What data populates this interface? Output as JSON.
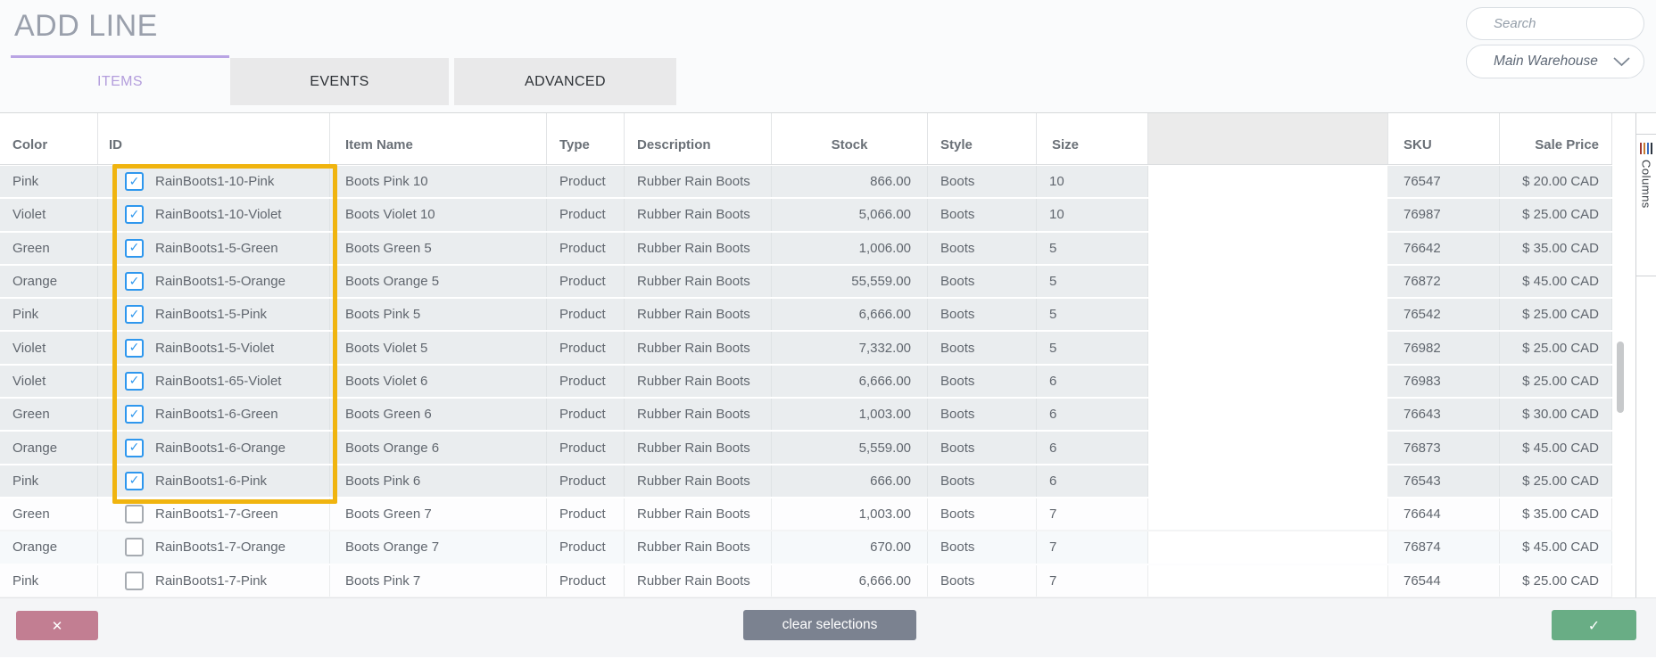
{
  "window": {
    "title": "ADD LINE"
  },
  "tabs": [
    {
      "label": "ITEMS",
      "active": true
    },
    {
      "label": "EVENTS",
      "active": false
    },
    {
      "label": "ADVANCED",
      "active": false
    }
  ],
  "search": {
    "placeholder": "Search"
  },
  "warehouse_dropdown": {
    "value": "Main Warehouse"
  },
  "columns_panel": {
    "label": "Columns"
  },
  "icons": {
    "check": "✓",
    "close": "✕",
    "search": "magnifier-icon",
    "chevron": "chevron-down-icon",
    "columns": "columns-bars-icon"
  },
  "colors": {
    "accent_purple": "#b39ddc",
    "tab_underline": "#b9a4e4",
    "highlight_yellow": "#f0b40f",
    "checkbox_blue": "#2e97ee",
    "selected_row_bg": "#eaedef",
    "cancel_button": "#c27e92",
    "clear_button": "#7b8290",
    "confirm_button": "#69ad85"
  },
  "table": {
    "columns": [
      "Color",
      "ID",
      "Item Name",
      "Type",
      "Description",
      "Stock",
      "Style",
      "Size",
      "",
      "SKU",
      "Sale Price"
    ],
    "rows": [
      {
        "color": "Pink",
        "id": "RainBoots1-10-Pink",
        "item_name": "Boots Pink 10",
        "type": "Product",
        "description": "Rubber Rain Boots",
        "stock": "866.00",
        "style": "Boots",
        "size": "10",
        "sku": "76547",
        "sale_price": "$ 20.00 CAD",
        "checked": true
      },
      {
        "color": "Violet",
        "id": "RainBoots1-10-Violet",
        "item_name": "Boots Violet 10",
        "type": "Product",
        "description": "Rubber Rain Boots",
        "stock": "5,066.00",
        "style": "Boots",
        "size": "10",
        "sku": "76987",
        "sale_price": "$ 25.00 CAD",
        "checked": true
      },
      {
        "color": "Green",
        "id": "RainBoots1-5-Green",
        "item_name": "Boots Green 5",
        "type": "Product",
        "description": "Rubber Rain Boots",
        "stock": "1,006.00",
        "style": "Boots",
        "size": "5",
        "sku": "76642",
        "sale_price": "$ 35.00 CAD",
        "checked": true
      },
      {
        "color": "Orange",
        "id": "RainBoots1-5-Orange",
        "item_name": "Boots Orange 5",
        "type": "Product",
        "description": "Rubber Rain Boots",
        "stock": "55,559.00",
        "style": "Boots",
        "size": "5",
        "sku": "76872",
        "sale_price": "$ 45.00 CAD",
        "checked": true
      },
      {
        "color": "Pink",
        "id": "RainBoots1-5-Pink",
        "item_name": "Boots Pink 5",
        "type": "Product",
        "description": "Rubber Rain Boots",
        "stock": "6,666.00",
        "style": "Boots",
        "size": "5",
        "sku": "76542",
        "sale_price": "$ 25.00 CAD",
        "checked": true
      },
      {
        "color": "Violet",
        "id": "RainBoots1-5-Violet",
        "item_name": "Boots Violet 5",
        "type": "Product",
        "description": "Rubber Rain Boots",
        "stock": "7,332.00",
        "style": "Boots",
        "size": "5",
        "sku": "76982",
        "sale_price": "$ 25.00 CAD",
        "checked": true
      },
      {
        "color": "Violet",
        "id": "RainBoots1-65-Violet",
        "item_name": "Boots Violet 6",
        "type": "Product",
        "description": "Rubber Rain Boots",
        "stock": "6,666.00",
        "style": "Boots",
        "size": "6",
        "sku": "76983",
        "sale_price": "$ 25.00 CAD",
        "checked": true
      },
      {
        "color": "Green",
        "id": "RainBoots1-6-Green",
        "item_name": "Boots Green 6",
        "type": "Product",
        "description": "Rubber Rain Boots",
        "stock": "1,003.00",
        "style": "Boots",
        "size": "6",
        "sku": "76643",
        "sale_price": "$ 30.00 CAD",
        "checked": true
      },
      {
        "color": "Orange",
        "id": "RainBoots1-6-Orange",
        "item_name": "Boots Orange 6",
        "type": "Product",
        "description": "Rubber Rain Boots",
        "stock": "5,559.00",
        "style": "Boots",
        "size": "6",
        "sku": "76873",
        "sale_price": "$ 45.00 CAD",
        "checked": true
      },
      {
        "color": "Pink",
        "id": "RainBoots1-6-Pink",
        "item_name": "Boots Pink 6",
        "type": "Product",
        "description": "Rubber Rain Boots",
        "stock": "666.00",
        "style": "Boots",
        "size": "6",
        "sku": "76543",
        "sale_price": "$ 25.00 CAD",
        "checked": true
      },
      {
        "color": "Green",
        "id": "RainBoots1-7-Green",
        "item_name": "Boots Green 7",
        "type": "Product",
        "description": "Rubber Rain Boots",
        "stock": "1,003.00",
        "style": "Boots",
        "size": "7",
        "sku": "76644",
        "sale_price": "$ 35.00 CAD",
        "checked": false
      },
      {
        "color": "Orange",
        "id": "RainBoots1-7-Orange",
        "item_name": "Boots Orange 7",
        "type": "Product",
        "description": "Rubber Rain Boots",
        "stock": "670.00",
        "style": "Boots",
        "size": "7",
        "sku": "76874",
        "sale_price": "$ 45.00 CAD",
        "checked": false
      },
      {
        "color": "Pink",
        "id": "RainBoots1-7-Pink",
        "item_name": "Boots Pink 7",
        "type": "Product",
        "description": "Rubber Rain Boots",
        "stock": "6,666.00",
        "style": "Boots",
        "size": "7",
        "sku": "76544",
        "sale_price": "$ 25.00 CAD",
        "checked": false
      }
    ]
  },
  "footer": {
    "clear_label": "clear selections"
  }
}
